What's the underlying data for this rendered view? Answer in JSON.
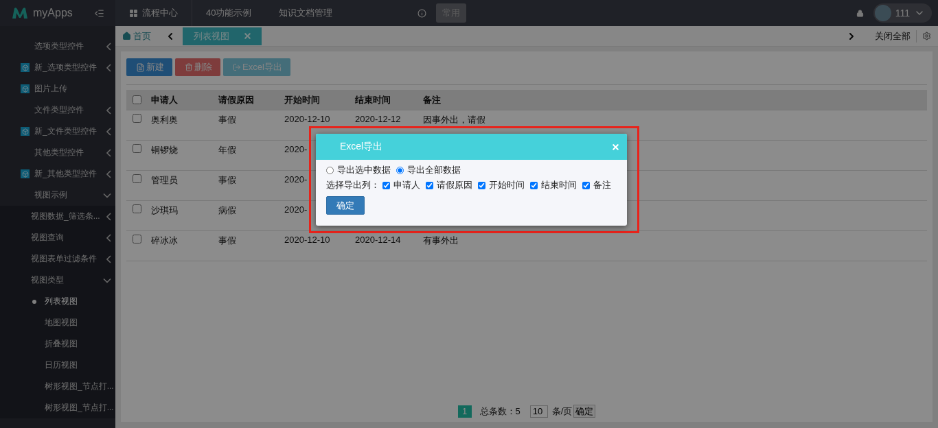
{
  "header": {
    "app_name": "myApps",
    "nav": [
      {
        "label": "流程中心",
        "icon": true
      },
      {
        "label": "40功能示例",
        "icon": false
      },
      {
        "label": "知识文档管理",
        "icon": false
      }
    ],
    "shortcut": "常用",
    "user": {
      "name": "111"
    }
  },
  "sidebar": {
    "items": [
      {
        "label": "选项类型控件",
        "icon": false,
        "expanded": false
      },
      {
        "label": "新_选项类型控件",
        "icon": true,
        "expanded": false
      },
      {
        "label": "图片上传",
        "icon": true
      },
      {
        "label": "文件类型控件",
        "icon": false,
        "expanded": false
      },
      {
        "label": "新_文件类型控件",
        "icon": true,
        "expanded": false
      },
      {
        "label": "其他类型控件",
        "icon": false,
        "expanded": false
      },
      {
        "label": "新_其他类型控件",
        "icon": true,
        "expanded": false
      },
      {
        "label": "视图示例",
        "icon": false,
        "expanded": true,
        "children": [
          {
            "label": "视图数据_筛选条...",
            "expanded": false
          },
          {
            "label": "视图查询",
            "expanded": false
          },
          {
            "label": "视图表单过滤条件",
            "expanded": false
          },
          {
            "label": "视图类型",
            "expanded": true,
            "children": [
              {
                "label": "列表视图",
                "selected": true
              },
              {
                "label": "地图视图",
                "selected": false
              },
              {
                "label": "折叠视图",
                "selected": false
              },
              {
                "label": "日历视图",
                "selected": false
              },
              {
                "label": "树形视图_节点打...",
                "selected": false
              },
              {
                "label": "树形视图_节点打...",
                "selected": false
              }
            ]
          }
        ]
      }
    ]
  },
  "tabs": {
    "home": "首页",
    "items": [
      {
        "label": "列表视图",
        "selected": true
      }
    ],
    "close_all": "关闭全部"
  },
  "toolbar": [
    {
      "label": "新建",
      "kind": "new"
    },
    {
      "label": "删除",
      "kind": "delete"
    },
    {
      "label": "Excel导出",
      "kind": "export"
    }
  ],
  "table": {
    "all_checked": false,
    "columns": [
      "申请人",
      "请假原因",
      "开始时间",
      "结束时间",
      "备注"
    ],
    "rows": [
      {
        "checked": false,
        "cells": [
          "奥利奥",
          "事假",
          "2020-12-10",
          "2020-12-12",
          "因事外出，请假"
        ]
      },
      {
        "checked": false,
        "cells": [
          "铜锣烧",
          "年假",
          "2020-"
        ]
      },
      {
        "checked": false,
        "cells": [
          "管理员",
          "事假",
          "2020-"
        ]
      },
      {
        "checked": false,
        "cells": [
          "沙琪玛",
          "病假",
          "2020-"
        ]
      },
      {
        "checked": false,
        "cells": [
          "碎冰冰",
          "事假",
          "2020-12-10",
          "2020-12-14",
          "有事外出"
        ]
      }
    ]
  },
  "pagination": {
    "pages": [
      {
        "label": "1",
        "selected": true
      }
    ],
    "total_label": "总条数：",
    "total": "5",
    "page_size": "10",
    "per_page": "条/页",
    "go": "确定"
  },
  "dialog": {
    "title": "Excel导出",
    "scope": [
      {
        "label": "导出选中数据",
        "selected": false
      },
      {
        "label": "导出全部数据",
        "selected": true
      }
    ],
    "columns_label": "选择导出列：",
    "columns": [
      {
        "label": "申请人",
        "checked": true
      },
      {
        "label": "请假原因",
        "checked": true
      },
      {
        "label": "开始时间",
        "checked": true
      },
      {
        "label": "结束时间",
        "checked": true
      },
      {
        "label": "备注",
        "checked": true
      }
    ],
    "confirm": "确定"
  }
}
